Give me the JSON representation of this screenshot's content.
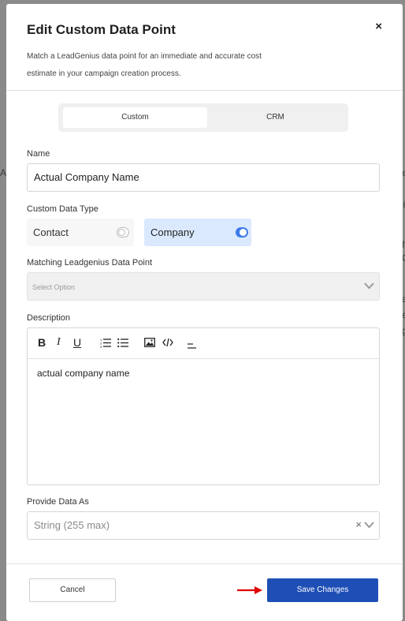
{
  "background": {
    "peek_left": "A",
    "peek_right_1": "e",
    "peek_right_2": "li",
    "peek_right_3": "f",
    "peek_right_4": "C",
    "peek_right_5": "a",
    "peek_right_6": "e",
    "peek_right_7": "g"
  },
  "modal": {
    "title": "Edit Custom Data Point",
    "close_glyph": "×",
    "subtitle": "Match a LeadGenius data point for an immediate and accurate cost estimate in your campaign creation process."
  },
  "tabs": [
    {
      "label": "Custom",
      "active": true
    },
    {
      "label": "CRM",
      "active": false
    }
  ],
  "form": {
    "name_label": "Name",
    "name_value": "Actual Company Name",
    "type_label": "Custom Data Type",
    "type_options": [
      {
        "label": "Contact",
        "on": false
      },
      {
        "label": "Company",
        "on": true
      }
    ],
    "matching_label": "Matching Leadgenius Data Point",
    "matching_placeholder": "Select Option",
    "description_label": "Description",
    "description_text": "actual company name",
    "toolbar": {
      "bold": "B",
      "italic": "I",
      "underline": "U"
    },
    "provide_label": "Provide Data As",
    "provide_value": "String (255 max)",
    "clear_glyph": "×"
  },
  "footer": {
    "cancel_label": "Cancel",
    "save_label": "Save Changes"
  },
  "colors": {
    "primary": "#1e4fb6",
    "selected_bg": "#dbe9ff",
    "toggle_on": "#3f7be8",
    "arrow": "#e00000"
  }
}
